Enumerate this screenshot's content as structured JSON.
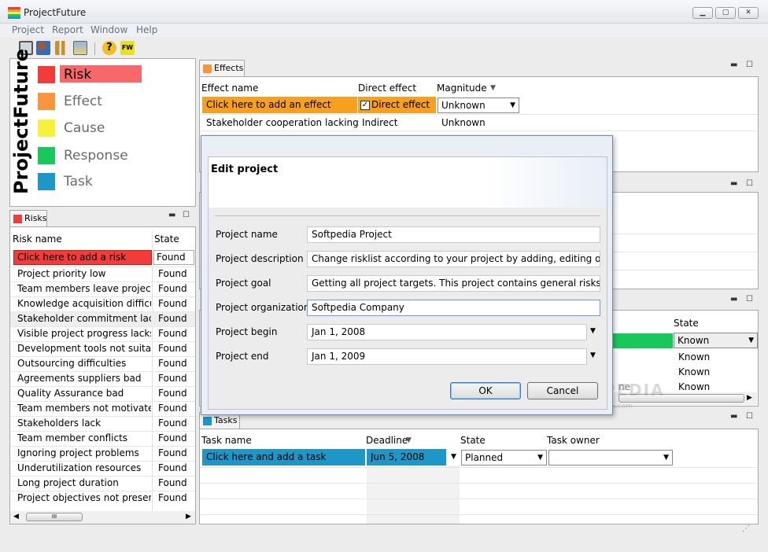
{
  "window": {
    "title": "ProjectFuture",
    "min": "▁",
    "max": "▢",
    "close": "✕"
  },
  "menu": [
    "Project",
    "Report",
    "Window",
    "Help"
  ],
  "toolbar": [
    "save-icon",
    "users-icon",
    "chart-icon",
    "image-icon",
    "help-icon",
    "fw-icon"
  ],
  "toolbar_fw": "FW",
  "legend": {
    "vertical_title": "ProjectFuture",
    "items": [
      {
        "label": "Risk",
        "color": "#f23c3c"
      },
      {
        "label": "Effect",
        "color": "#f7963c"
      },
      {
        "label": "Cause",
        "color": "#f7f03c"
      },
      {
        "label": "Response",
        "color": "#19c85a"
      },
      {
        "label": "Task",
        "color": "#1e96c8"
      }
    ]
  },
  "risks": {
    "tab": "Risks",
    "col_name": "Risk name",
    "col_state": "State",
    "add_row": "Click here to add a risk",
    "add_state": "Found",
    "rows": [
      [
        "Project priority low",
        "Found"
      ],
      [
        "Team members leave project",
        "Found"
      ],
      [
        "Knowledge acquisition difficult",
        "Found"
      ],
      [
        "Stakeholder commitment lacks",
        "Found"
      ],
      [
        "Visible project progress lacks",
        "Found"
      ],
      [
        "Development tools not suitable",
        "Found"
      ],
      [
        "Outsourcing difficulties",
        "Found"
      ],
      [
        "Agreements suppliers bad",
        "Found"
      ],
      [
        "Quality Assurance bad",
        "Found"
      ],
      [
        "Team members not motivated",
        "Found"
      ],
      [
        "Stakeholders lack",
        "Found"
      ],
      [
        "Team member conflicts",
        "Found"
      ],
      [
        "Ignoring project problems",
        "Found"
      ],
      [
        "Underutilization resources",
        "Found"
      ],
      [
        "Long project duration",
        "Found"
      ],
      [
        "Project objectives not present",
        "Found"
      ]
    ],
    "scroll_grip": "III"
  },
  "effects": {
    "tab": "Effects",
    "col_name": "Effect name",
    "col_direct": "Direct effect",
    "col_mag": "Magnitude",
    "add_row": "Click here to add an effect",
    "add_direct": "Direct effect",
    "add_mag": "Unknown",
    "rows": [
      [
        "Stakeholder cooperation lacking",
        "Indirect",
        "Unknown"
      ]
    ]
  },
  "responses": {
    "col_state": "State",
    "state_selected": "Known",
    "rows": [
      "Known",
      "Known",
      "Known"
    ],
    "partial": "ne"
  },
  "tasks": {
    "tab": "Tasks",
    "col_name": "Task name",
    "col_deadline": "Deadline",
    "col_state": "State",
    "col_owner": "Task owner",
    "add_row": "Click here and add a task",
    "add_deadline": "Jun 5, 2008",
    "add_state": "Planned",
    "add_owner": ""
  },
  "dialog": {
    "title": "Edit project",
    "fields": [
      {
        "label": "Project name",
        "value": "Softpedia Project"
      },
      {
        "label": "Project description",
        "value": "Change risklist according to your project by adding, editing or"
      },
      {
        "label": "Project goal",
        "value": "Getting all project targets. This project contains general risks which"
      },
      {
        "label": "Project organization",
        "value": "Softpedia Company"
      },
      {
        "label": "Project begin",
        "value": "Jan 1, 2008"
      },
      {
        "label": "Project end",
        "value": "Jan 1, 2009"
      }
    ],
    "ok": "OK",
    "cancel": "Cancel"
  },
  "watermark": "SOFTPEDIA",
  "watermark_sub": "www.softpedia.com"
}
